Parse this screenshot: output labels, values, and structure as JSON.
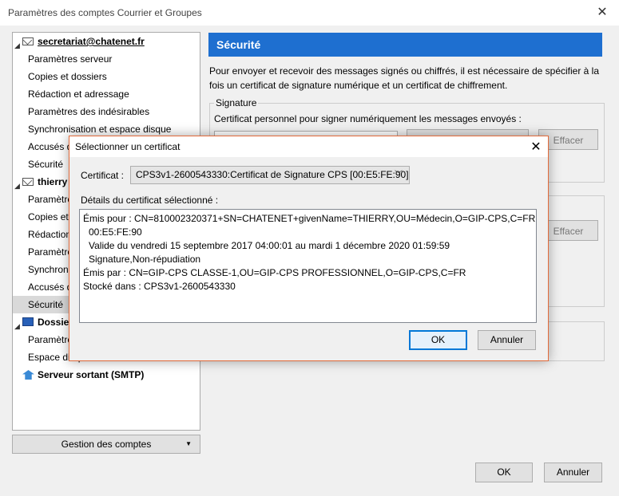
{
  "window": {
    "title": "Paramètres des comptes Courrier et Groupes",
    "close_glyph": "✕"
  },
  "tree": {
    "items": [
      {
        "type": "account",
        "label": "secretariat@chatenet.fr",
        "underline": true
      },
      {
        "type": "child",
        "label": "Paramètres serveur"
      },
      {
        "type": "child",
        "label": "Copies et dossiers"
      },
      {
        "type": "child",
        "label": "Rédaction et adressage"
      },
      {
        "type": "child",
        "label": "Paramètres des indésirables"
      },
      {
        "type": "child",
        "label": "Synchronisation et espace disque"
      },
      {
        "type": "child",
        "label": "Accusés de réception"
      },
      {
        "type": "child",
        "label": "Sécurité"
      },
      {
        "type": "account",
        "label": "thierry"
      },
      {
        "type": "child",
        "label": "Paramètres serveur"
      },
      {
        "type": "child",
        "label": "Copies et dossiers"
      },
      {
        "type": "child",
        "label": "Rédaction et adressage"
      },
      {
        "type": "child",
        "label": "Paramètres des indésirables"
      },
      {
        "type": "child",
        "label": "Synchronisation et espace disque"
      },
      {
        "type": "child",
        "label": "Accusés de réception"
      },
      {
        "type": "child",
        "label": "Sécurité",
        "selected": true
      },
      {
        "type": "local",
        "label": "Dossiers locaux"
      },
      {
        "type": "child",
        "label": "Paramètres des indésirables"
      },
      {
        "type": "child",
        "label": "Espace disque"
      },
      {
        "type": "smtp",
        "label": "Serveur sortant (SMTP)"
      }
    ],
    "gestion_label": "Gestion des comptes"
  },
  "panel": {
    "header": "Sécurité",
    "description": "Pour envoyer et recevoir des messages signés ou chiffrés, il est nécessaire de spécifier à la fois un certificat de signature numérique et un certificat de chiffrement.",
    "signature_legend": "Signature",
    "signature_text": "Certificat personnel pour signer numériquement les messages envoyés :",
    "effacer_label": "Effacer",
    "effacer2_label": "Effacer"
  },
  "footer": {
    "ok_label": "OK",
    "cancel_label": "Annuler"
  },
  "dialog": {
    "title": "Sélectionner un certificat",
    "certificate_label": "Certificat :",
    "certificate_value": "CPS3v1-2600543330:Certificat de Signature CPS [00:E5:FE:90]",
    "details_label": "Détails du certificat sélectionné :",
    "details": {
      "issued_to": "Émis pour : CN=810002320371+SN=CHATENET+givenName=THIERRY,OU=Médecin,O=GIP-CPS,C=FR",
      "serial": "00:E5:FE:90",
      "validity": "Valide du vendredi 15 septembre 2017 04:00:01 au mardi 1 décembre 2020 01:59:59",
      "usage": "Signature,Non-répudiation",
      "issued_by": "Émis par : CN=GIP-CPS CLASSE-1,OU=GIP-CPS PROFESSIONNEL,O=GIP-CPS,C=FR",
      "stored_in": "Stocké dans : CPS3v1-2600543330"
    },
    "ok_label": "OK",
    "cancel_label": "Annuler"
  },
  "colors": {
    "header_blue": "#1e6fd0",
    "dialog_border": "#e26a3a",
    "focus_blue": "#0078d7"
  }
}
